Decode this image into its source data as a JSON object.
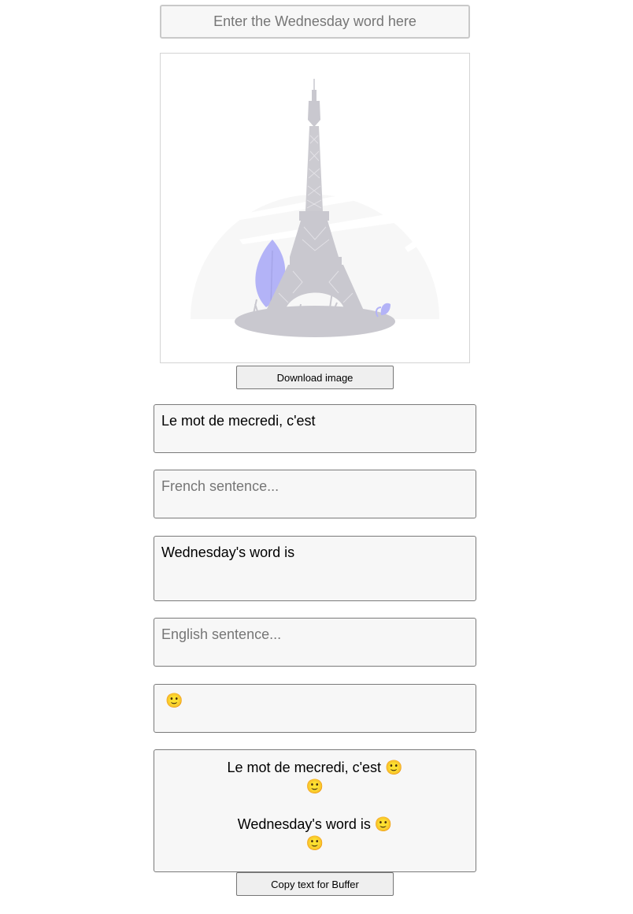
{
  "word_input": {
    "placeholder": "Enter the Wednesday word here",
    "value": ""
  },
  "image": {
    "icon": "eiffel-tower-illustration"
  },
  "download_button": {
    "label": "Download image"
  },
  "french_prefix": {
    "value": "Le mot de mecredi, c'est"
  },
  "french_sentence": {
    "placeholder": "French sentence...",
    "value": ""
  },
  "english_prefix": {
    "value": "Wednesday's word is"
  },
  "english_sentence": {
    "placeholder": "English sentence...",
    "value": ""
  },
  "emoji_field": {
    "value": "🙂"
  },
  "output": {
    "line1": "Le mot de mecredi, c'est 🙂",
    "line2": "🙂",
    "line3": "",
    "line4": "Wednesday's word is 🙂",
    "line5": "🙂"
  },
  "copy_button": {
    "label": "Copy text for Buffer"
  },
  "colors": {
    "tower": "#c9c8cf",
    "leaf": "#b3b3f7",
    "circle": "#f7f7f7"
  }
}
